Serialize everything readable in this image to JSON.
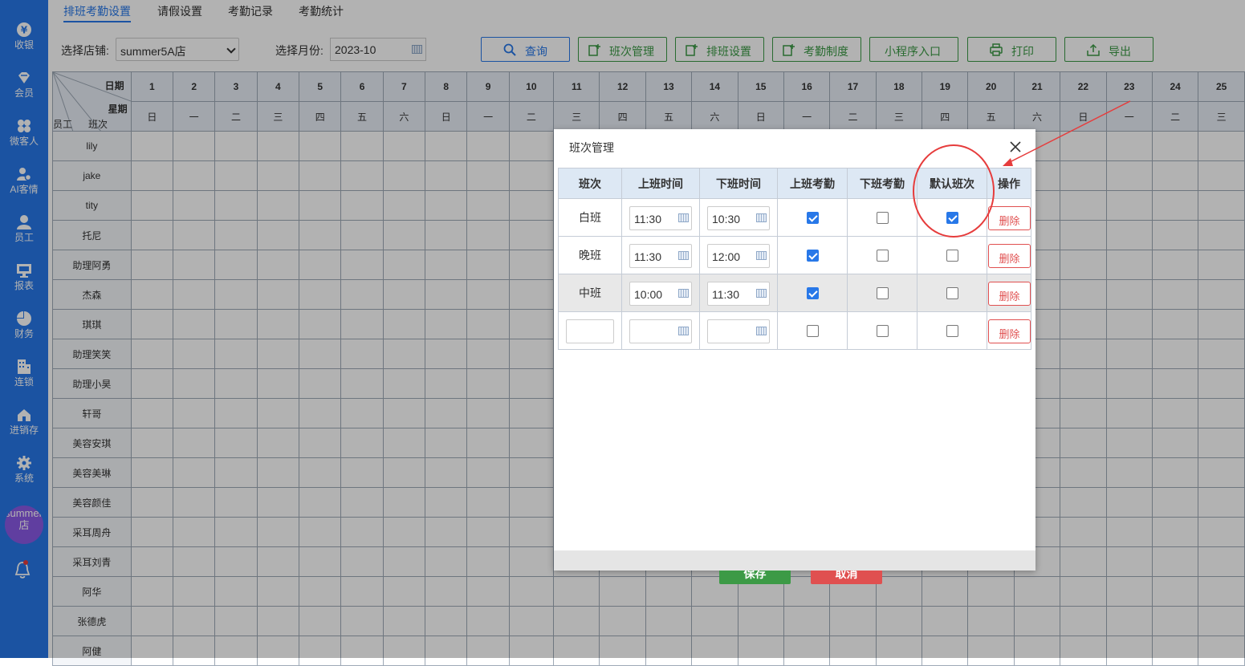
{
  "sidebar": {
    "items": [
      {
        "label": "收银",
        "icon": "yen-coin-icon"
      },
      {
        "label": "会员",
        "icon": "diamond-icon"
      },
      {
        "label": "微客人",
        "icon": "clover-icon"
      },
      {
        "label": "AI客情",
        "icon": "person-gear-icon"
      },
      {
        "label": "员工",
        "icon": "person-icon"
      },
      {
        "label": "报表",
        "icon": "monitor-icon"
      },
      {
        "label": "财务",
        "icon": "pie-chart-icon"
      },
      {
        "label": "连锁",
        "icon": "building-icon"
      },
      {
        "label": "进销存",
        "icon": "house-icon"
      },
      {
        "label": "系统",
        "icon": "gear-icon"
      }
    ],
    "store_avatar": "summer5A店",
    "bell_icon": "bell-icon"
  },
  "tabs": [
    {
      "label": "排班考勤设置",
      "active": true
    },
    {
      "label": "请假设置",
      "active": false
    },
    {
      "label": "考勤记录",
      "active": false
    },
    {
      "label": "考勤统计",
      "active": false
    }
  ],
  "toolbar": {
    "store_label": "选择店铺:",
    "store_value": "summer5A店",
    "month_label": "选择月份:",
    "month_value": "2023-10",
    "buttons": [
      {
        "label": "查询",
        "icon": "search-icon"
      },
      {
        "label": "班次管理",
        "icon": "edit-plus-icon"
      },
      {
        "label": "排班设置",
        "icon": "edit-plus-icon"
      },
      {
        "label": "考勤制度",
        "icon": "edit-plus-icon"
      },
      {
        "label": "小程序入口",
        "icon": ""
      },
      {
        "label": "打印",
        "icon": "printer-icon"
      },
      {
        "label": "导出",
        "icon": "upload-icon"
      }
    ]
  },
  "schedule": {
    "corner": {
      "date": "日期",
      "weekday": "星期",
      "employee": "员工",
      "shift": "班次"
    },
    "days": [
      "1",
      "2",
      "3",
      "4",
      "5",
      "6",
      "7",
      "8",
      "9",
      "10",
      "11",
      "12",
      "13",
      "14",
      "15",
      "16",
      "17",
      "18",
      "19",
      "20",
      "21",
      "22",
      "23",
      "24",
      "25"
    ],
    "weekdays": [
      "日",
      "一",
      "二",
      "三",
      "四",
      "五",
      "六",
      "日",
      "一",
      "二",
      "三",
      "四",
      "五",
      "六",
      "日",
      "一",
      "二",
      "三",
      "四",
      "五",
      "六",
      "日",
      "一",
      "二",
      "三"
    ],
    "employees": [
      "lily",
      "jake",
      "tity",
      "托尼",
      "助理阿勇",
      "杰森",
      "琪琪",
      "助理笑笑",
      "助理小昊",
      "轩哥",
      "美容安琪",
      "美容美琳",
      "美容颜佳",
      "采耳周舟",
      "采耳刘青",
      "阿华",
      "张德虎",
      "阿健"
    ]
  },
  "modal": {
    "title": "班次管理",
    "close_icon": "close-icon",
    "headers": [
      "班次",
      "上班时间",
      "下班时间",
      "上班考勤",
      "下班考勤",
      "默认班次",
      "操作"
    ],
    "rows": [
      {
        "name": "白班",
        "start": "11:30",
        "end": "10:30",
        "clock_in": true,
        "clock_out": false,
        "default": true,
        "action": "删除"
      },
      {
        "name": "晚班",
        "start": "11:30",
        "end": "12:00",
        "clock_in": true,
        "clock_out": false,
        "default": false,
        "action": "删除"
      },
      {
        "name": "中班",
        "start": "10:00",
        "end": "11:30",
        "clock_in": true,
        "clock_out": false,
        "default": false,
        "action": "删除"
      },
      {
        "name": "",
        "start": "",
        "end": "",
        "clock_in": false,
        "clock_out": false,
        "default": false,
        "action": "删除"
      }
    ],
    "save_label": "保存",
    "cancel_label": "取消"
  },
  "colors": {
    "sidebar": "#2878e8",
    "accent": "#2878e8",
    "green": "#3c9a46",
    "save": "#3c9a46",
    "cancel": "#e05050",
    "annotation": "#e63c3c"
  }
}
